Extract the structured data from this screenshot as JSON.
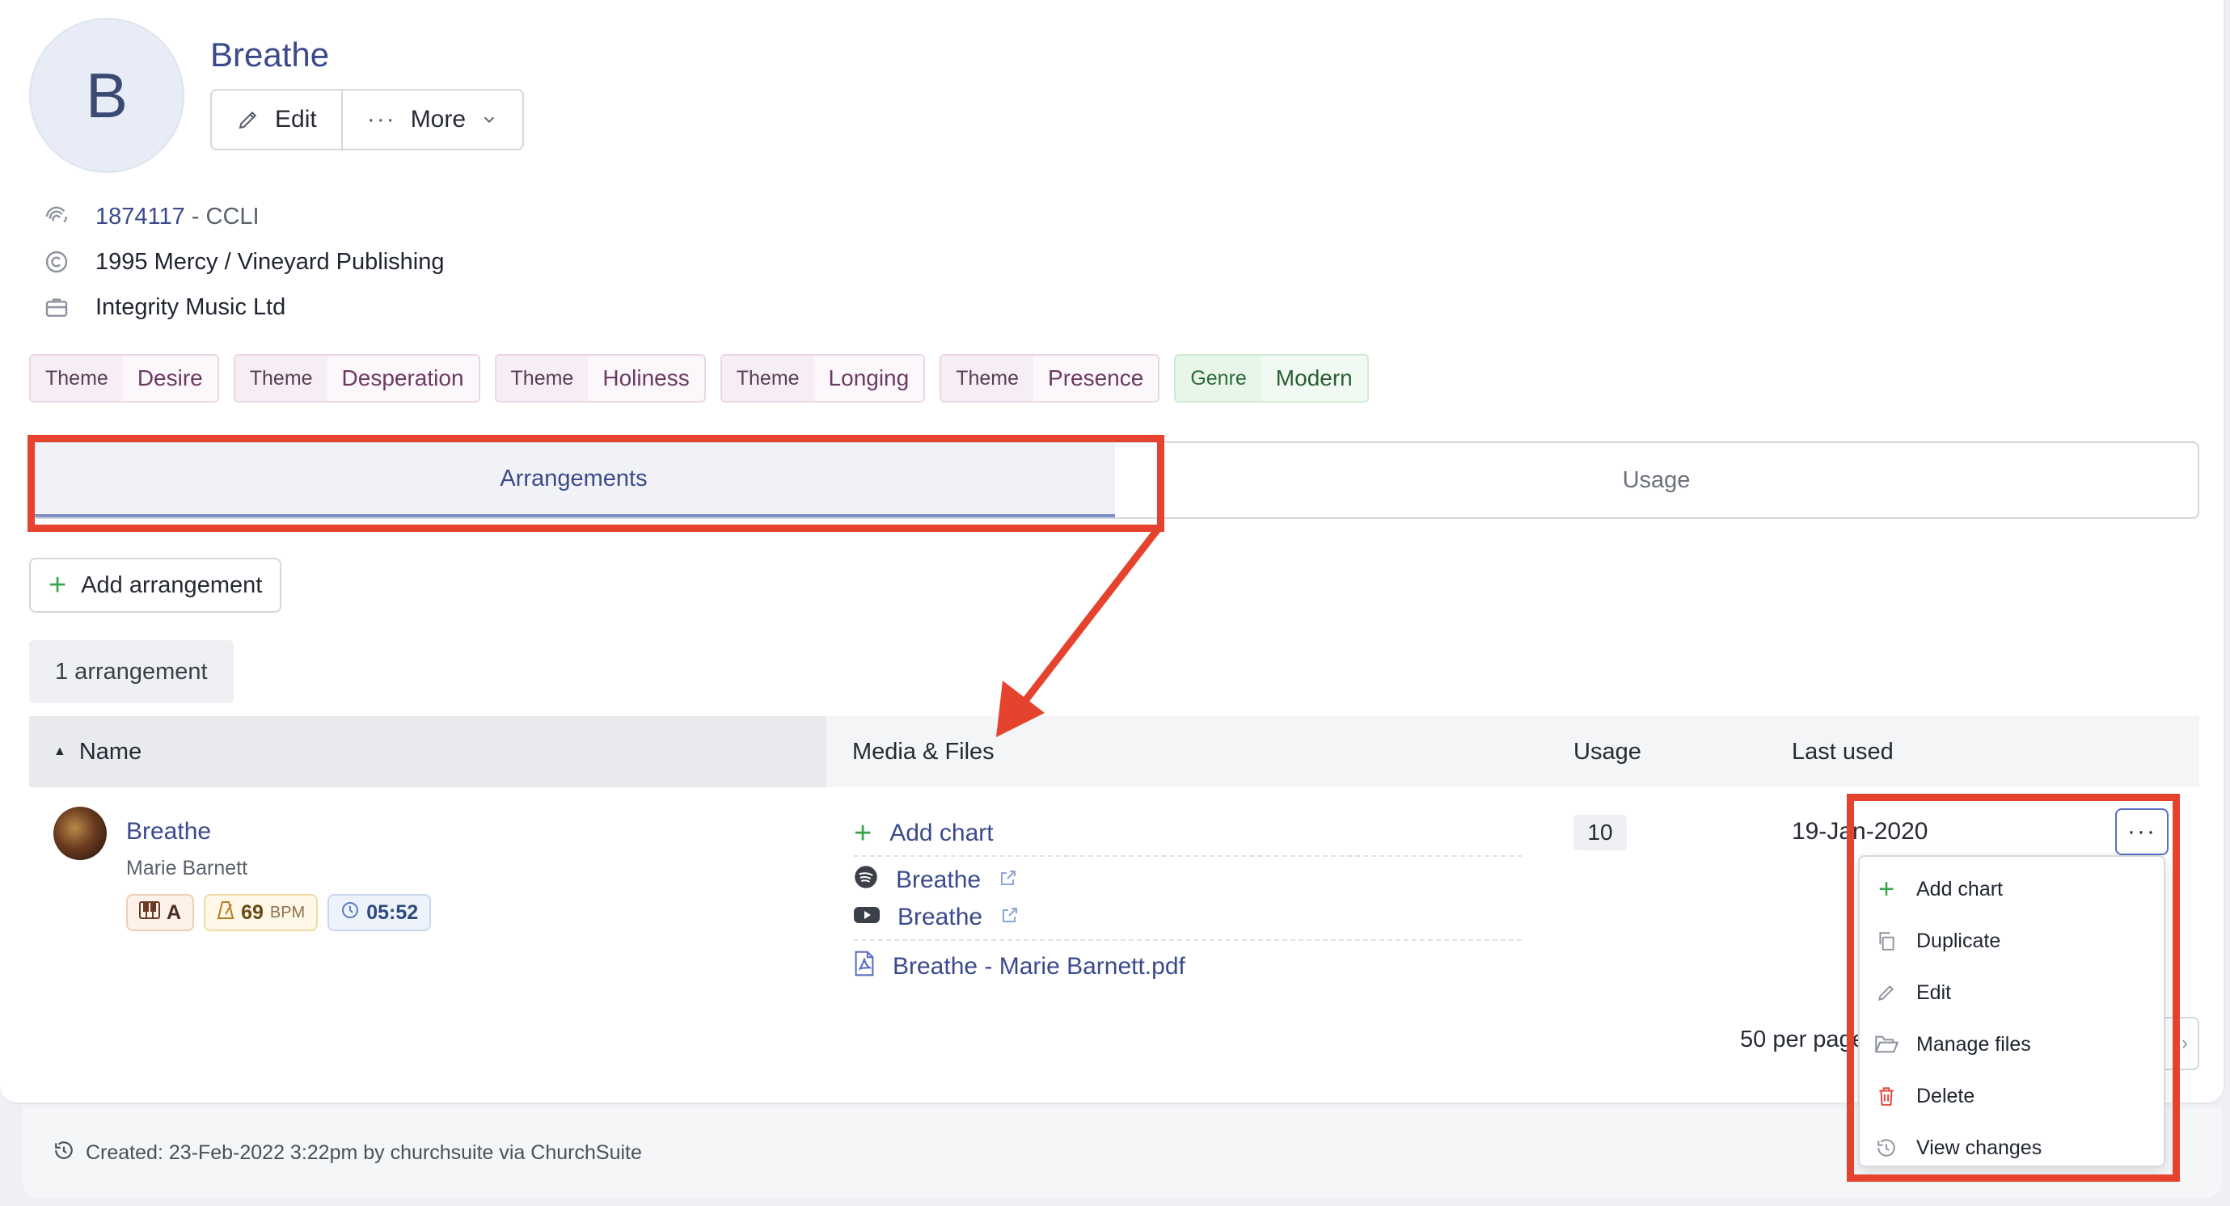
{
  "song": {
    "avatar_letter": "B",
    "title": "Breathe",
    "actions": {
      "edit_label": "Edit",
      "more_label": "More"
    },
    "ccli_number": "1874117",
    "ccli_suffix": "- CCLI",
    "copyright": "1995 Mercy / Vineyard Publishing",
    "publisher": "Integrity Music Ltd",
    "tags": [
      {
        "key": "Theme",
        "value": "Desire"
      },
      {
        "key": "Theme",
        "value": "Desperation"
      },
      {
        "key": "Theme",
        "value": "Holiness"
      },
      {
        "key": "Theme",
        "value": "Longing"
      },
      {
        "key": "Theme",
        "value": "Presence"
      },
      {
        "key": "Genre",
        "value": "Modern"
      }
    ]
  },
  "tabs": [
    {
      "label": "Arrangements",
      "active": true
    },
    {
      "label": "Usage",
      "active": false
    }
  ],
  "add_arrangement_label": "Add arrangement",
  "arrangement_count": "1 arrangement",
  "table": {
    "columns": {
      "name": "Name",
      "media": "Media & Files",
      "usage": "Usage",
      "last_used": "Last used"
    },
    "rows": [
      {
        "title": "Breathe",
        "artist": "Marie Barnett",
        "key": "A",
        "bpm": "69",
        "bpm_unit": "BPM",
        "duration": "05:52",
        "media": {
          "add_chart": "Add chart",
          "spotify": "Breathe",
          "youtube": "Breathe",
          "pdf": "Breathe - Marie Barnett.pdf"
        },
        "usage": "10",
        "last_used": "19-Jan-2020"
      }
    ]
  },
  "row_menu": {
    "trigger": "···",
    "items": [
      "Add chart",
      "Duplicate",
      "Edit",
      "Manage files",
      "Delete",
      "View changes"
    ]
  },
  "pagination": {
    "per_page": "50 per page"
  },
  "footer": {
    "created": "Created: 23-Feb-2022 3:22pm by churchsuite via ChurchSuite"
  },
  "colors": {
    "annotation": "#e5432e",
    "link": "#3a4a8c",
    "accent_green": "#37a64a",
    "danger": "#e0453b"
  }
}
